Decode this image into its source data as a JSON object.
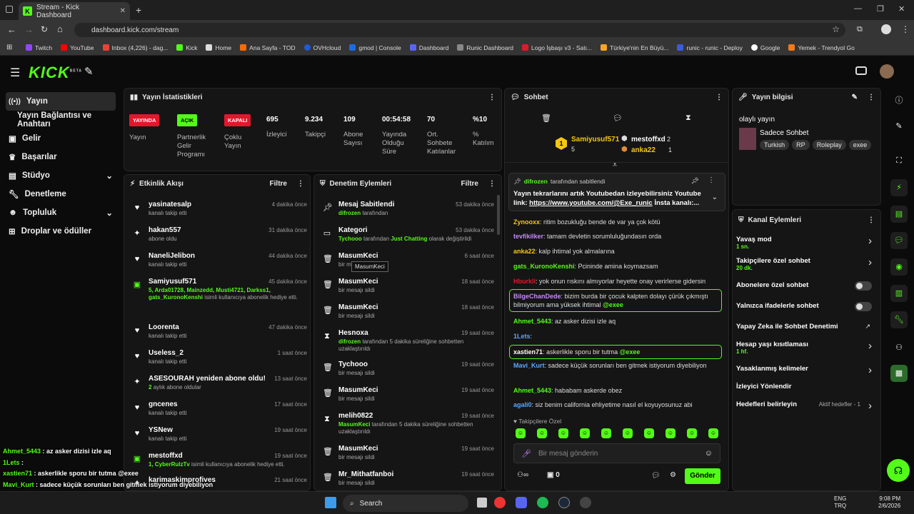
{
  "browser": {
    "tab_title": "Stream - Kick Dashboard",
    "url": "dashboard.kick.com/stream",
    "bookmarks": [
      "Twitch",
      "YouTube",
      "Inbox (4,226) - dag...",
      "Kick",
      "Home",
      "Ana Sayfa - TOD",
      "OVHcloud",
      "gmod | Console",
      "Dashboard",
      "Runic Dashboard",
      "Logo İşbaşı v3 - Satı...",
      "Türkiye'nin En Büyü...",
      "runic - runic - Deploy",
      "Google",
      "Yemek - Trendyol Go"
    ]
  },
  "logo": {
    "text": "KICK",
    "beta": "BETA"
  },
  "sidebar": {
    "items": [
      {
        "label": "Yayın"
      },
      {
        "label": "Yayın Bağlantısı ve Anahtarı"
      },
      {
        "label": "Gelir"
      },
      {
        "label": "Başarılar"
      },
      {
        "label": "Stüdyo"
      },
      {
        "label": "Denetleme"
      },
      {
        "label": "Topluluk"
      },
      {
        "label": "Droplar ve ödüller"
      }
    ]
  },
  "stats": {
    "title": "Yayın İstatistikleri",
    "badges": [
      {
        "text": "YAYINDA",
        "label": "Yayın",
        "color": "#e3172c"
      },
      {
        "text": "AÇIK",
        "label": "Partnerlik Gelir Programı",
        "color": "#53fc18"
      },
      {
        "text": "KAPALI",
        "label": "Çoklu Yayın",
        "color": "#e3172c"
      }
    ],
    "items": [
      {
        "value": "695",
        "label": "İzleyici"
      },
      {
        "value": "9.234",
        "label": "Takipçi"
      },
      {
        "value": "109",
        "label": "Abone Sayısı"
      },
      {
        "value": "00:54:58",
        "label": "Yayında Olduğu Süre"
      },
      {
        "value": "70",
        "label": "Ort. Sohbete Katılanlar"
      },
      {
        "value": "%10",
        "label": "% Katılım"
      }
    ]
  },
  "activity": {
    "title": "Etkinlik Akışı",
    "filter": "Filtre",
    "events": [
      {
        "name": "yasinatesalp",
        "time": "4 dakika önce",
        "sub": "kanalı takip etti",
        "icon": "heart-icon"
      },
      {
        "name": "hakan557",
        "time": "31 dakika önce",
        "sub": "abone oldu",
        "icon": "star-icon"
      },
      {
        "name": "NaneliJelibon",
        "time": "44 dakika önce",
        "sub": "kanalı takip etti",
        "icon": "heart-icon"
      },
      {
        "name": "Samiyusuf571",
        "time": "45 dakika önce",
        "green": "5, Arda01728, Mainzedd, Musti4721, Darkss1, gats_KuronoKenshi",
        "sub": "isimli kullanıcıya abonelik hediye etti.",
        "icon": "gift-icon"
      },
      {
        "name": "Loorenta",
        "time": "47 dakika önce",
        "sub": "kanalı takip etti",
        "icon": "heart-icon"
      },
      {
        "name": "Useless_2",
        "time": "1 saat önce",
        "sub": "kanalı takip etti",
        "icon": "heart-icon"
      },
      {
        "name": "ASESOURAH yeniden abone oldu!",
        "time": "13 saat önce",
        "green": "2",
        "sub": "aylık abone oldular",
        "icon": "star-icon"
      },
      {
        "name": "gncenes",
        "time": "17 saat önce",
        "sub": "kanalı takip etti",
        "icon": "heart-icon"
      },
      {
        "name": "YSNew",
        "time": "19 saat önce",
        "sub": "kanalı takip etti",
        "icon": "heart-icon"
      },
      {
        "name": "mestoffxd",
        "time": "19 saat önce",
        "green": "1, CyberRulzTv",
        "sub": "isimli kullanıcıya abonelik hediye etti.",
        "icon": "gift-icon"
      },
      {
        "name": "karimaskimprofives",
        "time": "21 saat önce",
        "sub": "",
        "icon": "star-icon"
      }
    ]
  },
  "moderation": {
    "title": "Denetim Eylemleri",
    "filter": "Filtre",
    "tooltip": "MasumKeci",
    "events": [
      {
        "name": "Mesaj Sabitlendi",
        "time": "53 dakika önce",
        "green": "difrozen",
        "sub": "tarafından",
        "icon": "pin-icon"
      },
      {
        "name": "Kategori",
        "time": "53 dakika önce",
        "green": "Tychooo",
        "sub": "tarafından",
        "green2": "Just Chatting",
        "sub2": "olarak değiştirildi",
        "icon": "category-icon"
      },
      {
        "name": "MasumKeci",
        "time": "6 saat önce",
        "sub": "bir mesajı sildi",
        "icon": "trash-icon"
      },
      {
        "name": "MasumKeci",
        "time": "18 saat önce",
        "sub": "bir mesajı sildi",
        "icon": "trash-icon"
      },
      {
        "name": "MasumKeci",
        "time": "18 saat önce",
        "sub": "bir mesajı sildi",
        "icon": "trash-icon"
      },
      {
        "name": "Hesnoxa",
        "time": "19 saat önce",
        "green": "difrozen",
        "sub": "tarafından 5 dakika süreliğine sohbetten uzaklaştırıldı",
        "icon": "hourglass-icon"
      },
      {
        "name": "Tychooo",
        "time": "19 saat önce",
        "sub": "bir mesajı sildi",
        "icon": "trash-icon"
      },
      {
        "name": "MasumKeci",
        "time": "19 saat önce",
        "sub": "bir mesajı sildi",
        "icon": "trash-icon"
      },
      {
        "name": "melih0822",
        "time": "19 saat önce",
        "green": "MasumKeci",
        "sub": "tarafından 5 dakika süreliğine sohbetten uzaklaştırıldı",
        "icon": "hourglass-icon"
      },
      {
        "name": "MasumKeci",
        "time": "19 saat önce",
        "sub": "bir mesajı sildi",
        "icon": "trash-icon"
      },
      {
        "name": "Mr_Mithatfanboi",
        "time": "19 saat önce",
        "sub": "bir mesajı sildi",
        "icon": "trash-icon"
      }
    ]
  },
  "chat": {
    "title": "Sohbet",
    "leaders": {
      "first": {
        "name": "Samiyusuf571",
        "count": "5"
      },
      "second": {
        "name": "mestoffxd",
        "count": "2"
      },
      "third": {
        "name": "anka22",
        "count": "1"
      }
    },
    "pinned": {
      "by": "difrozen",
      "by_suffix": "tarafından sabitlendi",
      "text": "Yayın tekrarlarını artık Youtubedan izleyebilirsiniz Youtube link:",
      "link": "https://www.youtube.com/@Exe_runic",
      "rest": "İnsta kanalı:..."
    },
    "messages": [
      {
        "user": "Zynooxx",
        "text": "ritim bozukluğu bende de var ya çok kötü",
        "color": "#f5c518"
      },
      {
        "user": "tevfikilker",
        "text": "tamam devletin sorumluluğundasın orda",
        "color": "#c58af9"
      },
      {
        "user": "anka22",
        "text": "kalp ihtimal yok almalarına",
        "color": "#f5c518"
      },
      {
        "user": "gats_KuronoKenshi",
        "text": "Pcininde amina koymazsam",
        "color": "#53fc18"
      },
      {
        "user": "Hburkli",
        "text": "yok onun rıskını almıyorlar heyette onay verirlerse gidersin",
        "color": "#e3172c"
      },
      {
        "user": "BilgeChanDede",
        "text": "bizim burda bir çocuk kalpten dolayı çürük çıkmıştı bilmiyorum ama yüksek ihtimal",
        "mention": "@exee",
        "color": "#c58af9"
      },
      {
        "user": "Ahmet_5443",
        "text": "az asker dizisi izle aq",
        "color": "#53fc18"
      },
      {
        "user": "1Lets",
        "text": "",
        "color": "#5aa8ff"
      },
      {
        "user": "xastien71",
        "text": "askerlikle sporu bir tutma",
        "mention": "@exee",
        "color": "#fff"
      },
      {
        "user": "Mavi_Kurt",
        "text": "sadece küçük sorunları ben gitmek istiyorum diyebiliyon",
        "color": "#5aa8ff"
      },
      {
        "user": "Ahmet_5443",
        "text": "hababam askerde obez",
        "color": "#53fc18"
      },
      {
        "user": "agali0",
        "text": "siz benim california ehliyetime nasıl el koyuyosunuz abi",
        "color": "#5aa8ff"
      }
    ],
    "emote_label": "Takipçilere Özel",
    "input_placeholder": "Bir mesaj gönderin",
    "send": "Gönder",
    "viewers": "0"
  },
  "info": {
    "title": "Yayın bilgisi",
    "stream_title": "olaylı yayın",
    "category": "Sadece Sohbet",
    "tags": [
      "Turkish",
      "RP",
      "Roleplay",
      "exee"
    ]
  },
  "channel": {
    "title": "Kanal Eylemleri",
    "actions": [
      {
        "label": "Yavaş mod",
        "value": "1 sn."
      },
      {
        "label": "Takipçilere özel sohbet",
        "value": "20 dk."
      },
      {
        "label": "Abonelere özel sohbet"
      },
      {
        "label": "Yalnızca ifadelerle sohbet"
      },
      {
        "label": "Yapay Zeka ile Sohbet Denetimi"
      },
      {
        "label": "Hesap yaşı kısıtlaması",
        "value": "1 hf."
      },
      {
        "label": "Yasaklanmış kelimeler"
      },
      {
        "label": "İzleyici Yönlendir"
      },
      {
        "label": "Hedefleri belirleyin",
        "extra": "Aktif hedefler - 1"
      }
    ]
  },
  "overlay": [
    {
      "user": "Ahmet_5443",
      "text": "az asker dizisi izle aq"
    },
    {
      "user": "1Lets",
      "text": ""
    },
    {
      "user": "xastien71",
      "text": "askerlikle sporu bir tutma @exee"
    },
    {
      "user": "Mavi_Kurt",
      "text": "sadece küçük sorunları ben gitmek istiyorum diyebiliyon"
    },
    {
      "user": "Ahmet_5443",
      "text": "hababam askerde obez"
    },
    {
      "user": "agali0",
      "text": "siz benim california ehliyetime nasıl el koyuyosunuz abi"
    }
  ],
  "taskbar": {
    "search": "Search",
    "lang1": "ENG",
    "lang2": "TRQ",
    "time": "9:08 PM",
    "date": "2/6/2026"
  }
}
